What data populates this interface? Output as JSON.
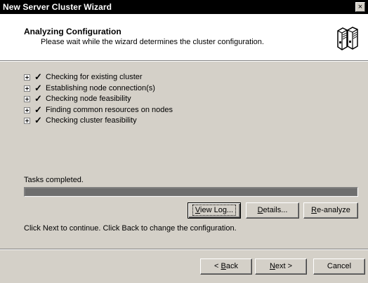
{
  "window": {
    "title": "New Server Cluster Wizard",
    "close_label": "×"
  },
  "header": {
    "title": "Analyzing Configuration",
    "subtitle": "Please wait while the wizard determines the cluster configuration.",
    "icon": "server-cluster-icon"
  },
  "tasks": [
    {
      "label": "Checking for existing cluster",
      "status_icon": "checkmark-icon"
    },
    {
      "label": "Establishing node connection(s)",
      "status_icon": "checkmark-icon"
    },
    {
      "label": "Checking node feasibility",
      "status_icon": "checkmark-icon"
    },
    {
      "label": "Finding common resources on nodes",
      "status_icon": "checkmark-icon"
    },
    {
      "label": "Checking cluster feasibility",
      "status_icon": "checkmark-icon"
    }
  ],
  "check_glyph": "✓",
  "status_text": "Tasks completed.",
  "progress_percent": 100,
  "buttons": {
    "view_log": {
      "accel": "V",
      "rest": "iew Log..."
    },
    "details": {
      "accel": "D",
      "rest": "etails..."
    },
    "reanalyze": {
      "accel": "R",
      "rest": "e-analyze"
    },
    "back": {
      "prefix": "< ",
      "accel": "B",
      "rest": "ack"
    },
    "next": {
      "accel": "N",
      "rest": "ext >"
    },
    "cancel": {
      "label": "Cancel"
    }
  },
  "info_text": "Click Next to continue. Click Back to change the configuration."
}
